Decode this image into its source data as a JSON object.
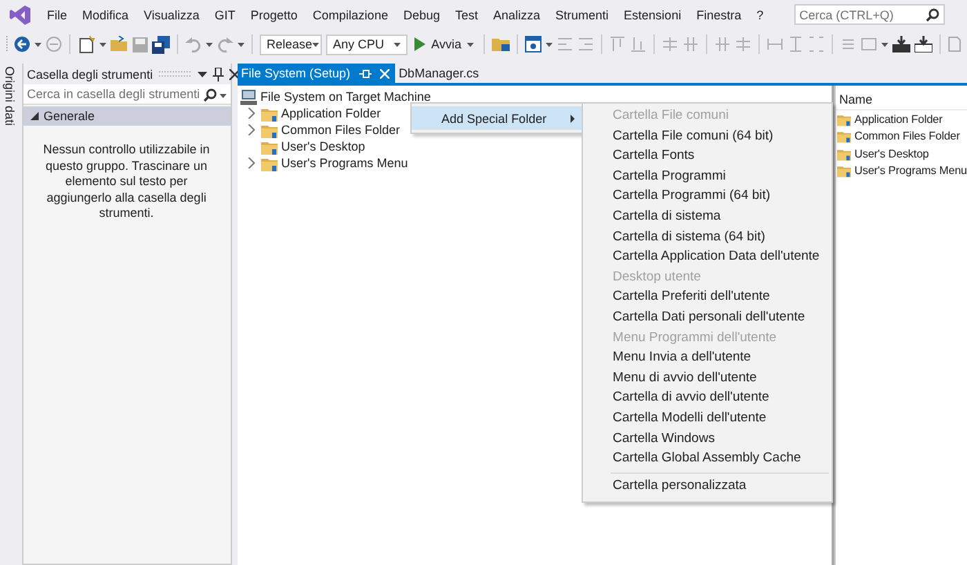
{
  "menu_bar": {
    "items": [
      "File",
      "Modifica",
      "Visualizza",
      "GIT",
      "Progetto",
      "Compilazione",
      "Debug",
      "Test",
      "Analizza",
      "Strumenti",
      "Estensioni",
      "Finestra",
      "?"
    ],
    "search": {
      "placeholder": "Cerca (CTRL+Q)"
    }
  },
  "toolbar": {
    "configuration": "Release",
    "platform": "Any CPU",
    "run_label": "Avvia"
  },
  "side_strip": {
    "label": "Origini dati"
  },
  "toolbox": {
    "title": "Casella degli strumenti",
    "search": {
      "placeholder": "Cerca in casella degli strumenti"
    },
    "group": {
      "label": "Generale",
      "expanded": true
    },
    "message": "Nessun controllo utilizzabile in questo gruppo. Trascinare un elemento sul testo per aggiungerlo alla casella degli strumenti."
  },
  "tabs": [
    {
      "label": "File System (Setup)",
      "selected": true
    },
    {
      "label": "DbManager.cs",
      "selected": false
    }
  ],
  "tree": {
    "root": "File System on Target Machine",
    "children": [
      {
        "label": "Application Folder",
        "kind": "branch"
      },
      {
        "label": "Common Files Folder",
        "kind": "branch"
      },
      {
        "label": "User's Desktop",
        "kind": "leaf"
      },
      {
        "label": "User's Programs Menu",
        "kind": "branch"
      }
    ]
  },
  "list_pane": {
    "column": "Name",
    "items": [
      "Application Folder",
      "Common Files Folder",
      "User's Desktop",
      "User's Programs Menu"
    ]
  },
  "context_menu": {
    "items": [
      {
        "label": "Add Special Folder",
        "expanded": true
      }
    ]
  },
  "submenu": {
    "groups": [
      {
        "items": [
          {
            "label": "Cartella File comuni",
            "disabled": true
          },
          {
            "label": "Cartella File comuni (64 bit)",
            "disabled": false
          },
          {
            "label": "Cartella Fonts",
            "disabled": false
          },
          {
            "label": "Cartella Programmi",
            "disabled": false
          },
          {
            "label": "Cartella Programmi (64 bit)",
            "disabled": false
          },
          {
            "label": "Cartella di sistema",
            "disabled": false
          },
          {
            "label": "Cartella di sistema (64 bit)",
            "disabled": false
          },
          {
            "label": "Cartella Application Data dell'utente",
            "disabled": false
          },
          {
            "label": "Desktop utente",
            "disabled": true
          },
          {
            "label": "Cartella Preferiti dell'utente",
            "disabled": false
          },
          {
            "label": "Cartella Dati personali dell'utente",
            "disabled": false
          },
          {
            "label": "Menu Programmi dell'utente",
            "disabled": true
          },
          {
            "label": "Menu Invia a dell'utente",
            "disabled": false
          },
          {
            "label": "Menu di avvio dell'utente",
            "disabled": false
          },
          {
            "label": "Cartella di avvio dell'utente",
            "disabled": false
          },
          {
            "label": "Cartella Modelli dell'utente",
            "disabled": false
          },
          {
            "label": "Cartella Windows",
            "disabled": false
          },
          {
            "label": "Cartella Global Assembly Cache",
            "disabled": false
          }
        ]
      },
      {
        "items": [
          {
            "label": "Cartella personalizzata",
            "disabled": false
          }
        ]
      }
    ]
  }
}
